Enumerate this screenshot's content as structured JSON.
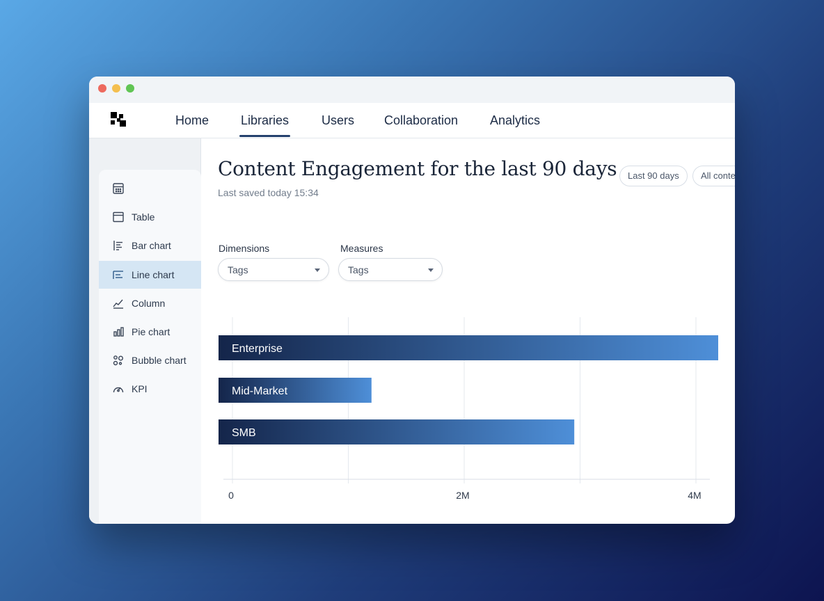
{
  "nav": {
    "items": [
      {
        "label": "Home"
      },
      {
        "label": "Libraries"
      },
      {
        "label": "Users"
      },
      {
        "label": "Collaboration"
      },
      {
        "label": "Analytics"
      }
    ]
  },
  "sidebar": {
    "items": [
      {
        "label": "",
        "icon": "calculator-icon"
      },
      {
        "label": "Table",
        "icon": "table-icon"
      },
      {
        "label": "Bar chart",
        "icon": "bar-chart-icon"
      },
      {
        "label": "Line chart",
        "icon": "line-chart-icon"
      },
      {
        "label": "Column",
        "icon": "trend-line-icon"
      },
      {
        "label": "Pie chart",
        "icon": "column-chart-icon"
      },
      {
        "label": "Bubble chart",
        "icon": "bubble-chart-icon"
      },
      {
        "label": "KPI",
        "icon": "gauge-icon"
      }
    ]
  },
  "page": {
    "title": "Content Engagement for the last 90 days",
    "saved": "Last saved today 15:34",
    "filters": [
      "Last 90 days",
      "All conte"
    ]
  },
  "fields": {
    "dimensions_label": "Dimensions",
    "dimensions_value": "Tags",
    "measures_label": "Measures",
    "measures_value": "Tags"
  },
  "colors": {
    "bar_start": "#14254a",
    "bar_end": "#4e8fd8",
    "active_item": "#d5e6f4"
  },
  "chart_data": {
    "type": "bar",
    "orientation": "horizontal",
    "categories": [
      "Enterprise",
      "Mid-Market",
      "SMB"
    ],
    "values": [
      4300000,
      1200000,
      2950000
    ],
    "xlim": [
      0,
      4000000
    ],
    "xticks": [
      {
        "value": 0,
        "label": "0"
      },
      {
        "value": 2000000,
        "label": "2M"
      },
      {
        "value": 4000000,
        "label": "4M"
      }
    ],
    "grid": true
  }
}
